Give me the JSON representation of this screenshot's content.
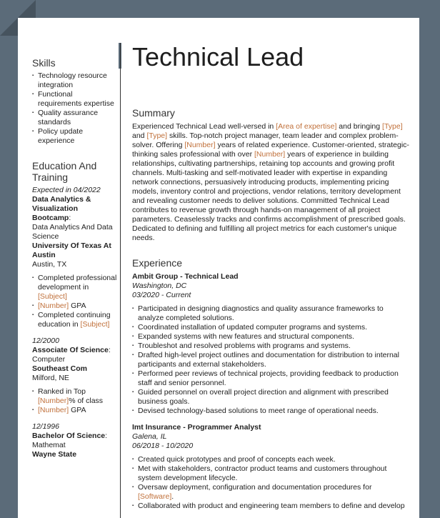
{
  "title": "Technical Lead",
  "sidebar": {
    "skills_title": "Skills",
    "skills": [
      "Technology resource integration",
      "Functional requirements expertise",
      "Quality assurance standards",
      "Policy update experience"
    ],
    "education_title": "Education And Training",
    "education": [
      {
        "date": "Expected in 04/2022",
        "degree": "Data Analytics & Visualization Bootcamp",
        "field": "Data Analytics And Data Science",
        "school": "University Of Texas At Austin",
        "location": "Austin, TX",
        "bullets": [
          {
            "pre": "Completed professional development in ",
            "ph": "[Subject]",
            "post": ""
          },
          {
            "pre": "",
            "ph": "[Number]",
            "post": " GPA"
          },
          {
            "pre": "Completed continuing education in ",
            "ph": "[Subject]",
            "post": ""
          }
        ]
      },
      {
        "date": "12/2000",
        "degree": "Associate Of Science",
        "field": "Computer",
        "school": "Southeast Com",
        "location": "Milford, NE",
        "bullets": [
          {
            "pre": "Ranked in Top ",
            "ph": "[Number]",
            "post": "% of class"
          },
          {
            "pre": "",
            "ph": "[Number]",
            "post": " GPA"
          }
        ]
      },
      {
        "date": "12/1996",
        "degree": "Bachelor Of Science",
        "field": "Mathemat",
        "school": "Wayne State",
        "location": "",
        "bullets": []
      }
    ]
  },
  "summary": {
    "title": "Summary",
    "parts": [
      {
        "t": "Experienced Technical Lead well-versed in "
      },
      {
        "p": "[Area of expertise]"
      },
      {
        "t": " and bringing "
      },
      {
        "p": "[Type]"
      },
      {
        "t": " and "
      },
      {
        "p": "[Type]"
      },
      {
        "t": " skills. Top-notch project manager, team leader and complex problem-solver. Offering "
      },
      {
        "p": "[Number]"
      },
      {
        "t": " years of related experience. Customer-oriented, strategic-thinking sales professional with over "
      },
      {
        "p": "[Number]"
      },
      {
        "t": " years of experience in building relationships, cultivating partnerships, retaining top accounts and growing profit channels. Multi-tasking and self-motivated leader with expertise in expanding network connections, persuasively introducing products, implementing pricing models, inventory control and projections, vendor relations, territory development and revealing customer needs to deliver solutions. Committed Technical Lead contributes to revenue growth through hands-on management of all project parameters. Ceaselessly tracks and confirms accomplishment of prescribed goals. Dedicated to defining and fulfilling all project metrics for each customer's unique needs."
      }
    ]
  },
  "experience": {
    "title": "Experience",
    "jobs": [
      {
        "heading": "Ambit Group - Technical Lead",
        "location": "Washington, DC",
        "dates": "03/2020 - Current",
        "bullets": [
          {
            "pre": "Participated in designing diagnostics and quality assurance frameworks to analyze completed solutions.",
            "ph": "",
            "post": ""
          },
          {
            "pre": "Coordinated installation of updated computer programs and systems.",
            "ph": "",
            "post": ""
          },
          {
            "pre": "Expanded systems with new features and structural components.",
            "ph": "",
            "post": ""
          },
          {
            "pre": "Troubleshot and resolved problems with programs and systems.",
            "ph": "",
            "post": ""
          },
          {
            "pre": "Drafted high-level project outlines and documentation for distribution to internal participants and external stakeholders.",
            "ph": "",
            "post": ""
          },
          {
            "pre": "Performed peer reviews of technical projects, providing feedback to production staff and senior personnel.",
            "ph": "",
            "post": ""
          },
          {
            "pre": "Guided personnel on overall project direction and alignment with prescribed business goals.",
            "ph": "",
            "post": ""
          },
          {
            "pre": "Devised technology-based solutions to meet range of operational needs.",
            "ph": "",
            "post": ""
          }
        ]
      },
      {
        "heading": "Imt Insurance - Programmer Analyst",
        "location": "Galena, IL",
        "dates": "06/2018 - 10/2020",
        "bullets": [
          {
            "pre": "Created quick prototypes and proof of concepts each week.",
            "ph": "",
            "post": ""
          },
          {
            "pre": "Met with stakeholders, contractor product teams and customers throughout system development lifecycle.",
            "ph": "",
            "post": ""
          },
          {
            "pre": "Oversaw deployment, configuration and documentation procedures for ",
            "ph": "[Software]",
            "post": "."
          },
          {
            "pre": "Collaborated with product and engineering team members to define and develop",
            "ph": "",
            "post": ""
          }
        ]
      }
    ]
  }
}
